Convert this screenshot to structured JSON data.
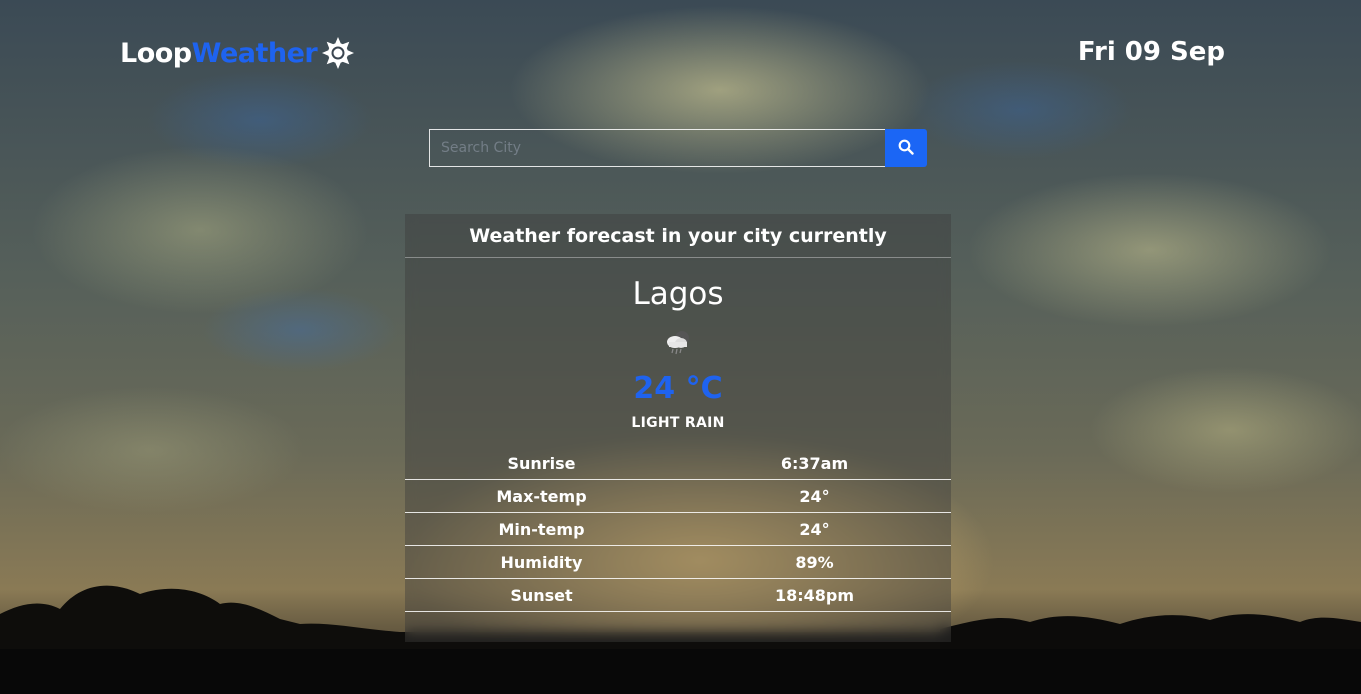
{
  "header": {
    "brand_part1": "Loop",
    "brand_part2": "Weather",
    "brand_icon": "sun-gear-icon",
    "date": "Fri 09 Sep"
  },
  "search": {
    "placeholder": "Search City",
    "value": "",
    "button_icon": "search-icon"
  },
  "card": {
    "heading": "Weather forecast in your city currently",
    "city": "Lagos",
    "weather_icon": "cloud-rain-icon",
    "temperature": "24 °C",
    "condition": "LIGHT RAIN",
    "details": [
      {
        "label": "Sunrise",
        "value": "6:37am"
      },
      {
        "label": "Max-temp",
        "value": "24°"
      },
      {
        "label": "Min-temp",
        "value": "24°"
      },
      {
        "label": "Humidity",
        "value": "89%"
      },
      {
        "label": "Sunset",
        "value": "18:48pm"
      }
    ]
  },
  "colors": {
    "accent": "#1e63f0",
    "button": "#1b66f5",
    "text": "#ffffff"
  }
}
